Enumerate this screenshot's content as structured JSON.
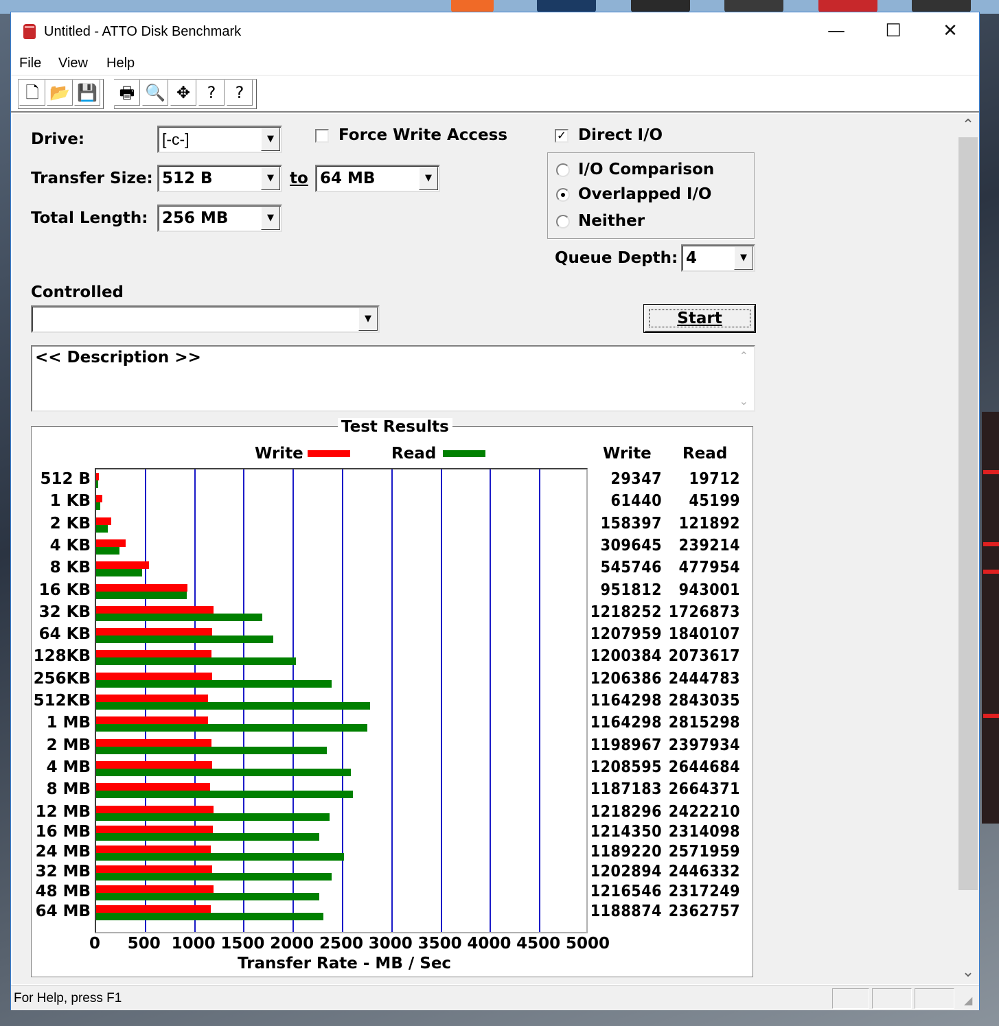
{
  "window": {
    "title": "Untitled - ATTO Disk Benchmark",
    "minimize": "—",
    "maximize": "☐",
    "close": "✕"
  },
  "menu": [
    "File",
    "View",
    "Help"
  ],
  "toolbar": {
    "new": "🗋",
    "open": "📂",
    "save": "💾",
    "print": "🖶",
    "preview": "🔍",
    "move": "✥",
    "help": "?",
    "whats_this": "?"
  },
  "form": {
    "drive_label": "Drive:",
    "drive_value": "[-c-]",
    "force_write_label": "Force Write Access",
    "force_write_checked": false,
    "direct_io_label": "Direct I/O",
    "direct_io_checked": true,
    "transfer_label": "Transfer Size:",
    "transfer_from": "512 B",
    "to_label": "to",
    "transfer_to": "64 MB",
    "total_label": "Total Length:",
    "total_value": "256 MB",
    "io_options": [
      {
        "label": "I/O Comparison",
        "selected": false
      },
      {
        "label": "Overlapped I/O",
        "selected": true
      },
      {
        "label": "Neither",
        "selected": false
      }
    ],
    "queue_label": "Queue Depth:",
    "queue_value": "4",
    "controlled_label": "Controlled",
    "controlled_value": "",
    "start_label": "Start",
    "description": "<< Description >>"
  },
  "chart_data": {
    "type": "bar",
    "title": "Test Results",
    "xlabel": "Transfer Rate - MB / Sec",
    "xlim": [
      0,
      5000
    ],
    "xticks": [
      0,
      500,
      1000,
      1500,
      2000,
      2500,
      3000,
      3500,
      4000,
      4500,
      5000
    ],
    "categories": [
      "512 B",
      "1 KB",
      "2 KB",
      "4 KB",
      "8 KB",
      "16 KB",
      "32 KB",
      "64 KB",
      "128KB",
      "256KB",
      "512KB",
      "1 MB",
      "2 MB",
      "4 MB",
      "8 MB",
      "12 MB",
      "16 MB",
      "24 MB",
      "32 MB",
      "48 MB",
      "64 MB"
    ],
    "series": [
      {
        "name": "Write",
        "color": "#ff0000",
        "values": [
          29347,
          61440,
          158397,
          309645,
          545746,
          951812,
          1218252,
          1207959,
          1200384,
          1206386,
          1164298,
          1164298,
          1198967,
          1208595,
          1187183,
          1218296,
          1214350,
          1189220,
          1202894,
          1216546,
          1188874
        ]
      },
      {
        "name": "Read",
        "color": "#008000",
        "values": [
          19712,
          45199,
          121892,
          239214,
          477954,
          943001,
          1726873,
          1840107,
          2073617,
          2444783,
          2843035,
          2815298,
          2397934,
          2644684,
          2664371,
          2422210,
          2314098,
          2571959,
          2446332,
          2317249,
          2362757
        ]
      }
    ],
    "column_headers": [
      "Write",
      "Read"
    ]
  },
  "status": {
    "text": "For Help, press F1"
  }
}
